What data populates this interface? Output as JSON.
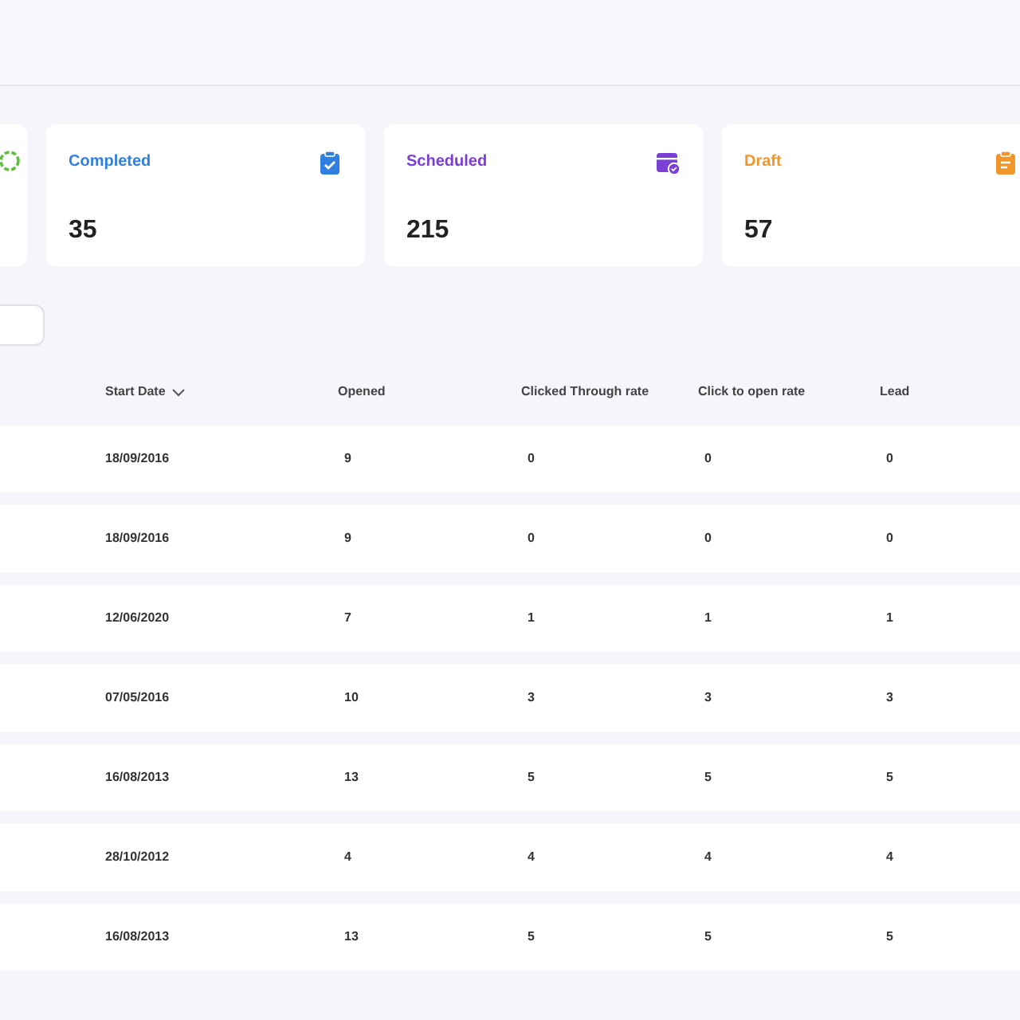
{
  "stats": [
    {
      "label": "Completed",
      "value": "35",
      "color": "#2f7fe0"
    },
    {
      "label": "Scheduled",
      "value": "215",
      "color": "#7b3fd6"
    },
    {
      "label": "Draft",
      "value": "57",
      "color": "#f0962a"
    }
  ],
  "table": {
    "columns": [
      {
        "label": "Start Date",
        "sortable": true
      },
      {
        "label": "Opened",
        "sortable": false
      },
      {
        "label": "Clicked Through rate",
        "sortable": false
      },
      {
        "label": "Click to open rate",
        "sortable": false
      },
      {
        "label": "Lead",
        "sortable": false
      }
    ],
    "rows": [
      [
        "18/09/2016",
        "9",
        "0",
        "0",
        "0"
      ],
      [
        "18/09/2016",
        "9",
        "0",
        "0",
        "0"
      ],
      [
        "12/06/2020",
        "7",
        "1",
        "1",
        "1"
      ],
      [
        "07/05/2016",
        "10",
        "3",
        "3",
        "3"
      ],
      [
        "16/08/2013",
        "13",
        "5",
        "5",
        "5"
      ],
      [
        "28/10/2012",
        "4",
        "4",
        "4",
        "4"
      ],
      [
        "16/08/2013",
        "13",
        "5",
        "5",
        "5"
      ]
    ]
  }
}
